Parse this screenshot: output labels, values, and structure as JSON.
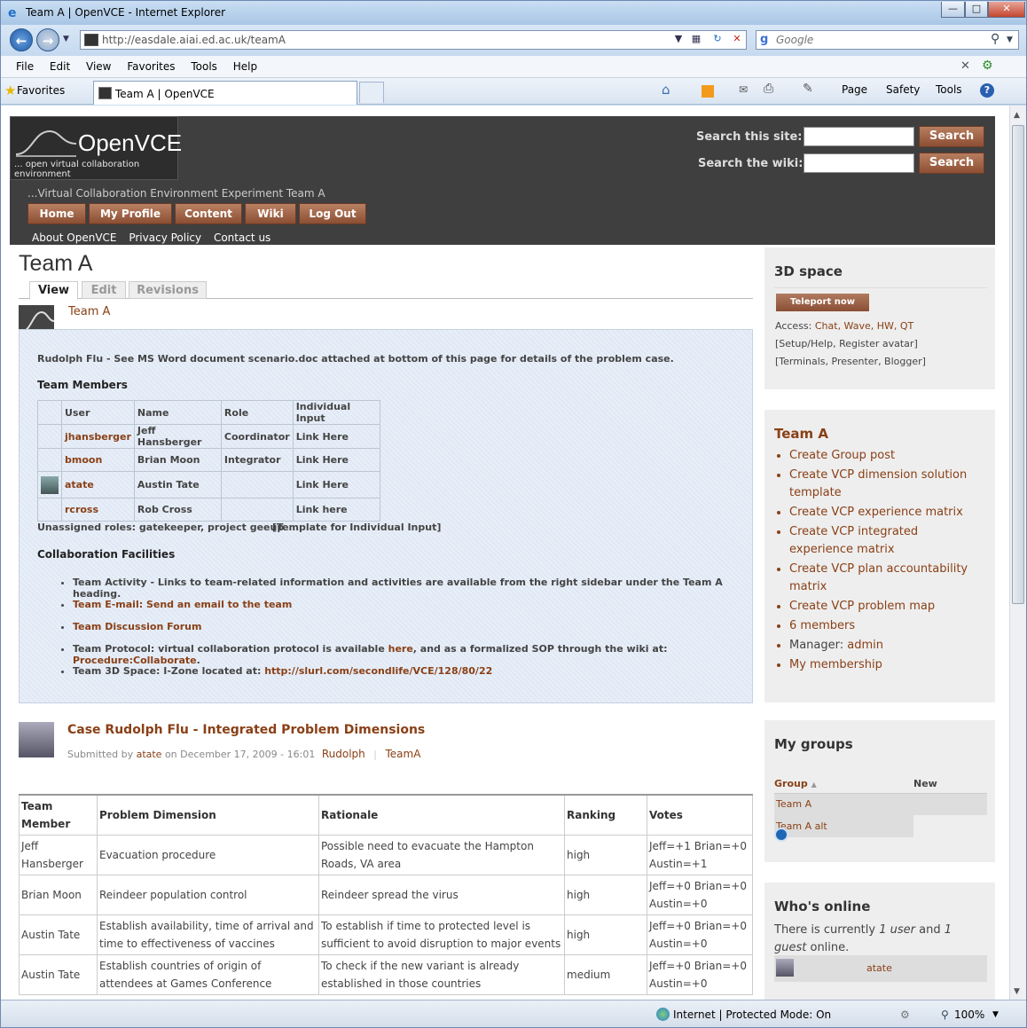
{
  "browser": {
    "window_title": "Team A | OpenVCE - Internet Explorer",
    "url": "http://easdale.aiai.ed.ac.uk/teamA",
    "search_placeholder": "Google",
    "menu": [
      "File",
      "Edit",
      "View",
      "Favorites",
      "Tools",
      "Help"
    ],
    "favorites_label": "Favorites",
    "tab_title": "Team A | OpenVCE",
    "toolbar": {
      "page": "Page",
      "safety": "Safety",
      "tools": "Tools"
    },
    "status_zone": "Internet | Protected Mode: On",
    "zoom": "100%"
  },
  "site": {
    "logo_text": "OpenVCE",
    "logo_subtitle": "... open virtual collaboration environment",
    "search_site_label": "Search this site:",
    "search_wiki_label": "Search the wiki:",
    "search_button": "Search",
    "slogan": "...Virtual Collaboration Environment Experiment Team A",
    "primary_nav": [
      "Home",
      "My Profile",
      "Content",
      "Wiki",
      "Log Out"
    ],
    "secondary_nav": [
      "About OpenVCE",
      "Privacy Policy",
      "Contact us"
    ]
  },
  "main": {
    "title": "Team A",
    "tabs": [
      "View",
      "Edit",
      "Revisions"
    ],
    "group_link": "Team A",
    "intro": "Rudolph Flu - See MS Word document scenario.doc attached at bottom of this page for details of the problem case.",
    "members_heading": "Team Members",
    "members_columns": [
      "User",
      "Name",
      "Role",
      "Individual Input"
    ],
    "members": [
      {
        "user": "jhansberger",
        "name": "Jeff Hansberger",
        "role": "Coordinator",
        "input": "Link Here"
      },
      {
        "user": "bmoon",
        "name": "Brian Moon",
        "role": "Integrator",
        "input": "Link Here"
      },
      {
        "user": "atate",
        "name": "Austin Tate",
        "role": "",
        "input": "Link Here"
      },
      {
        "user": "rcross",
        "name": "Rob Cross",
        "role": "",
        "input": "Link here"
      }
    ],
    "unassigned": "Unassigned roles: gatekeeper, project geeup",
    "template_link": "[Template for Individual Input]",
    "collab_heading": "Collaboration Facilities",
    "collab": {
      "activity": "Team Activity - Links to team-related information and activities are available from the right sidebar under the Team A heading.",
      "email": "Team E-mail: Send an email to the team",
      "forum": "Team Discussion Forum",
      "protocol_a": "Team Protocol: virtual collaboration protocol is available ",
      "protocol_here": "here",
      "protocol_b": ", and as a formalized SOP through the wiki at: ",
      "protocol_link": "Procedure:Collaborate",
      "protocol_end": ".",
      "space_a": "Team 3D Space:  I-Zone located at: ",
      "space_link": "http://slurl.com/secondlife/VCE/128/80/22"
    }
  },
  "post": {
    "title": "Case Rudolph Flu - Integrated Problem Dimensions",
    "submitted_by": "Submitted by ",
    "author": "atate",
    "date": " on December 17, 2009 - 16:01",
    "tag1": "Rudolph",
    "tag2": "TeamA",
    "columns": [
      "Team Member",
      "Problem Dimension",
      "Rationale",
      "Ranking",
      "Votes"
    ],
    "rows": [
      {
        "member": "Jeff Hansberger",
        "dimension": "Evacuation procedure",
        "rationale": "Possible need to evacuate the Hampton Roads, VA area",
        "ranking": "high",
        "votes": "Jeff=+1 Brian=+0 Austin=+1"
      },
      {
        "member": "Brian Moon",
        "dimension": "Reindeer population control",
        "rationale": "Reindeer spread the virus",
        "ranking": "high",
        "votes": "Jeff=+0 Brian=+0 Austin=+0"
      },
      {
        "member": "Austin Tate",
        "dimension": "Establish availability, time of arrival and time to effectiveness of vaccines",
        "rationale": "To establish if time to protected level is sufficient to avoid disruption to major events",
        "ranking": "high",
        "votes": "Jeff=+0 Brian=+0 Austin=+0"
      },
      {
        "member": "Austin Tate",
        "dimension": "Establish countries of origin of attendees at Games Conference",
        "rationale": "To check if the new variant is already established in those countries",
        "ranking": "medium",
        "votes": "Jeff=+0 Brian=+0 Austin=+0"
      }
    ]
  },
  "sidebar": {
    "space_title": "3D space",
    "teleport": "Teleport now",
    "access_label": "Access: ",
    "access_links": "Chat, Wave, HW, QT",
    "setup": "[Setup/Help, Register avatar]",
    "terminals": "[Terminals, Presenter, Blogger]",
    "team_title": "Team A",
    "team_links": [
      "Create Group post",
      "Create VCP dimension solution template",
      "Create VCP experience matrix",
      "Create VCP integrated experience matrix",
      "Create VCP plan accountability matrix",
      "Create VCP problem map",
      "6 members"
    ],
    "manager_label": "Manager: ",
    "manager": "admin",
    "membership": "My membership",
    "groups_title": "My groups",
    "groups_cols": [
      "Group",
      "New"
    ],
    "groups": [
      "Team A",
      "Team A alt"
    ],
    "online_title": "Who's online",
    "online_text_a": "There is currently ",
    "online_users": "1 user",
    "online_and": " and ",
    "online_guests": "1 guest",
    "online_text_b": " online.",
    "online_user": "atate"
  }
}
